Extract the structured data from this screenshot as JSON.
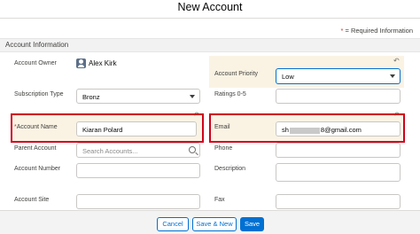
{
  "modal": {
    "title": "New Account"
  },
  "required_note": {
    "star": "*",
    "text": " = Required Information"
  },
  "section": {
    "title": "Account Information"
  },
  "fields": {
    "account_owner": {
      "label": "Account Owner",
      "value": "Alex Kirk"
    },
    "account_priority": {
      "label": "Account Priority",
      "value": "Low"
    },
    "subscription_type": {
      "label": "Subscription Type",
      "value": "Bronz"
    },
    "ratings": {
      "label": "Ratings 0-5",
      "value": ""
    },
    "account_name": {
      "star": "*",
      "label": "Account Name",
      "value": "Kiaran Polard"
    },
    "email": {
      "label": "Email",
      "value_prefix": "sh",
      "value_suffix": "8@gmail.com"
    },
    "parent_account": {
      "label": "Parent Account",
      "placeholder": "Search Accounts..."
    },
    "phone": {
      "label": "Phone",
      "value": ""
    },
    "account_number": {
      "label": "Account Number",
      "value": ""
    },
    "description": {
      "label": "Description",
      "value": ""
    },
    "account_site": {
      "label": "Account Site",
      "value": ""
    },
    "fax": {
      "label": "Fax",
      "value": ""
    }
  },
  "buttons": {
    "cancel": "Cancel",
    "save_new": "Save & New",
    "save": "Save"
  },
  "icons": {
    "undo": "undo-icon",
    "caret": "chevron-down-icon",
    "search": "search-icon",
    "owner": "user-icon"
  },
  "colors": {
    "brand": "#0070d2",
    "highlight": "#faf3e4",
    "annotation": "#d0021b",
    "required": "#c23934"
  }
}
